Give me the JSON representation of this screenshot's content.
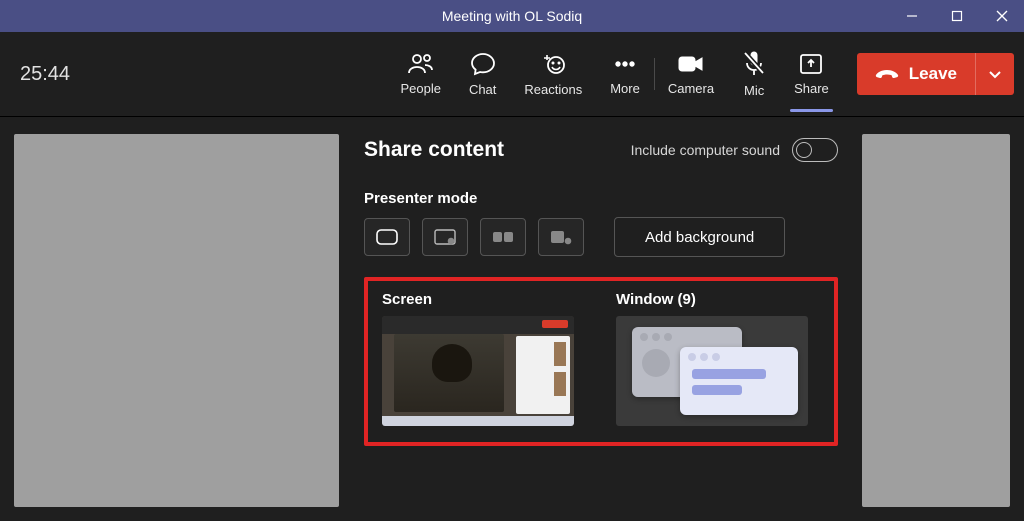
{
  "titlebar": {
    "title": "Meeting with OL Sodiq"
  },
  "toolbar": {
    "timer": "25:44",
    "people": "People",
    "chat": "Chat",
    "reactions": "Reactions",
    "more": "More",
    "camera": "Camera",
    "mic": "Mic",
    "share": "Share",
    "leave": "Leave"
  },
  "share_panel": {
    "title": "Share content",
    "sound_label": "Include computer sound",
    "presenter_mode": "Presenter mode",
    "add_background": "Add background",
    "screen_label": "Screen",
    "window_label": "Window (9)"
  }
}
